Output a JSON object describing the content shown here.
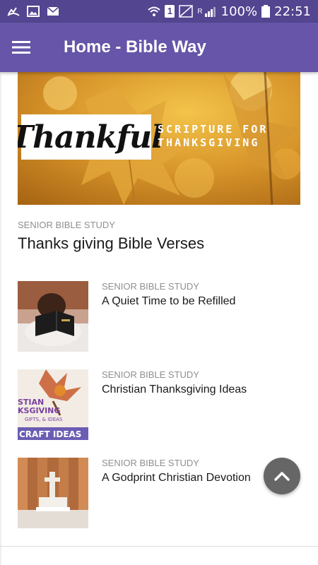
{
  "status_bar": {
    "battery": "100%",
    "time": "22:51",
    "sim_label": "1",
    "network_label": "R"
  },
  "app_bar": {
    "title": "Home - Bible Way"
  },
  "featured": {
    "badge_text": "Thankful",
    "subtitle_line1": "SCRIPTURE FOR",
    "subtitle_line2": "THANKSGIVING",
    "category": "SENIOR BIBLE STUDY",
    "title": "Thanks giving Bible Verses"
  },
  "articles": [
    {
      "category": "SENIOR BIBLE STUDY",
      "title": "A Quiet Time to be Refilled"
    },
    {
      "category": "SENIOR BIBLE STUDY",
      "title": "Christian Thanksgiving Ideas",
      "thumb_text1": "STIAN",
      "thumb_text2": "KSGIVING",
      "thumb_text3": "GIFTS, & IDEAS",
      "thumb_text4": "CRAFT IDEAS"
    },
    {
      "category": "SENIOR BIBLE STUDY",
      "title": "A Godprint Christian Devotion"
    }
  ],
  "colors": {
    "status_bar": "#534590",
    "app_bar": "#6655a8",
    "fab": "#666666"
  },
  "icons": {
    "menu": "hamburger-menu-icon",
    "scroll_top": "chevron-up-icon"
  }
}
